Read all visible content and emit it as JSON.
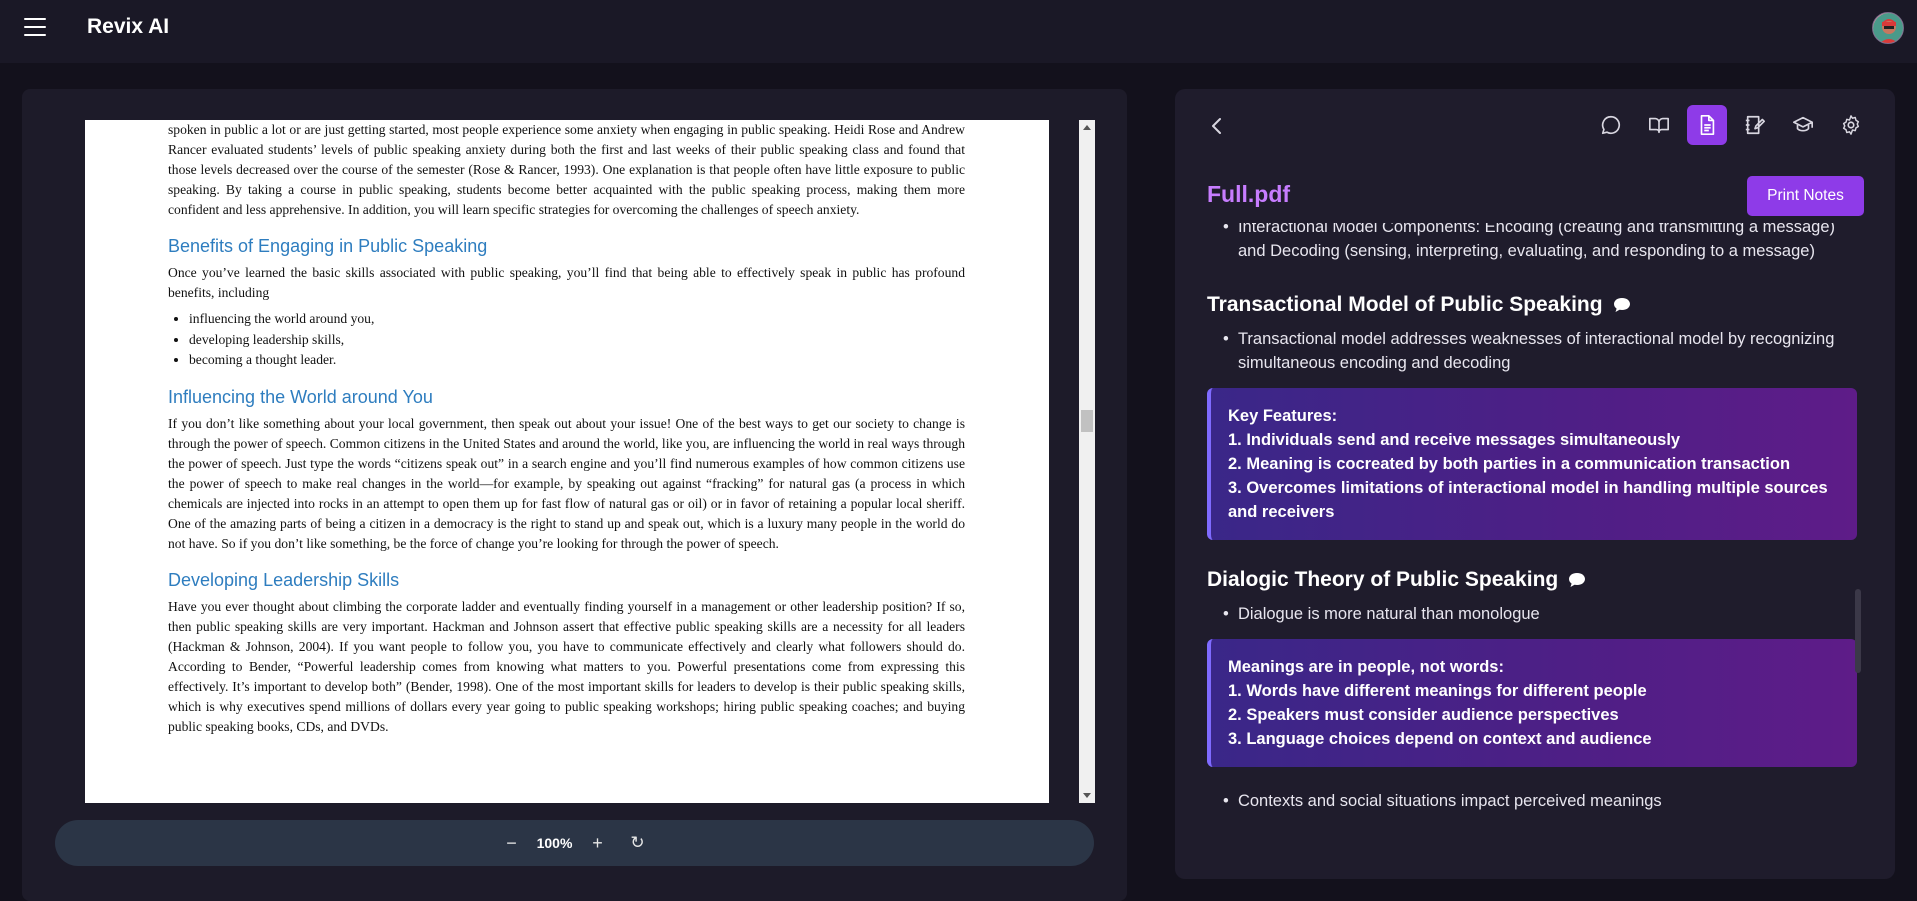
{
  "app": {
    "title": "Revix AI"
  },
  "pdf": {
    "intro": "spoken in public a lot or are just getting started, most people experience some anxiety when engaging in public speaking. Heidi Rose and Andrew Rancer evaluated students’ levels of public speaking anxiety during both the first and last weeks of their public speaking class and found that those levels decreased over the course of the semester (Rose & Rancer, 1993). One explanation is that people often have little exposure to public speaking. By taking a course in public speaking, students become better acquainted with the public speaking process, making them more confident and less apprehensive. In addition, you will learn specific strategies for overcoming the challenges of speech anxiety.",
    "h_benefits": "Benefits of Engaging in Public Speaking",
    "p_benefits": "Once you’ve learned the basic skills associated with public speaking, you’ll find that being able to effectively speak in public has profound benefits, including",
    "bullets": [
      "influencing the world around you,",
      "developing leadership skills,",
      "becoming a thought leader."
    ],
    "h_influencing": "Influencing the World around You",
    "p_influencing": "If you don’t like something about your local government, then speak out about your issue! One of the best ways to get our society to change is through the power of speech. Common citizens in the United States and around the world, like you, are influencing the world in real ways through the power of speech. Just type the words “citizens speak out” in a search engine and you’ll find numerous examples of how common citizens use the power of speech to make real changes in the world—for example, by speaking out against “fracking” for natural gas (a process in which chemicals are injected into rocks in an attempt to open them up for fast flow of natural gas or oil) or in favor of retaining a popular local sheriff. One of the amazing parts of being a citizen in a democracy is the right to stand up and speak out, which is a luxury many people in the world do not have. So if you don’t like something, be the force of change you’re looking for through the power of speech.",
    "h_leadership": "Developing Leadership Skills",
    "p_leadership": "Have you ever thought about climbing the corporate ladder and eventually finding yourself in a management or other leadership position? If so, then public speaking skills are very important. Hackman and Johnson assert that effective public speaking skills are a necessity for all leaders (Hackman & Johnson, 2004). If you want people to follow you, you have to communicate effectively and clearly what followers should do. According to Bender, “Powerful leadership comes from knowing what matters to you. Powerful presentations come from expressing this effectively. It’s important to develop both” (Bender, 1998). One of the most important skills for leaders to develop is their public speaking skills, which is why executives spend millions of dollars every year going to public speaking workshops; hiring public speaking coaches; and buying public speaking books, CDs, and DVDs."
  },
  "zoom": {
    "minus": "−",
    "level": "100%",
    "plus": "+",
    "reset": "↻"
  },
  "notes_panel": {
    "file_title": "Full.pdf",
    "print_label": "Print Notes",
    "active_tab": "notes",
    "bullet_top": "Interactional Model Components: Encoding (creating and transmitting a message) and Decoding (sensing, interpreting, evaluating, and responding to a message)",
    "section1_title": "Transactional Model of Public Speaking",
    "section1_bullet": "Transactional model addresses weaknesses of interactional model by recognizing simultaneous encoding and decoding",
    "callout1": [
      "Key Features:",
      "1. Individuals send and receive messages simultaneously",
      "2. Meaning is cocreated by both parties in a communication transaction",
      "3. Overcomes limitations of interactional model in handling multiple sources and receivers"
    ],
    "section2_title": "Dialogic Theory of Public Speaking",
    "section2_bullet": "Dialogue is more natural than monologue",
    "callout2": [
      "Meanings are in people, not words:",
      "1. Words have different meanings for different people",
      "2. Speakers must consider audience perspectives",
      "3. Language choices depend on context and audience"
    ],
    "bullet_bottom": "Contexts and social situations impact perceived meanings"
  },
  "colors": {
    "accent": "#8e3be8",
    "title": "#c77dff",
    "heading_blue": "#2e7dbf"
  }
}
